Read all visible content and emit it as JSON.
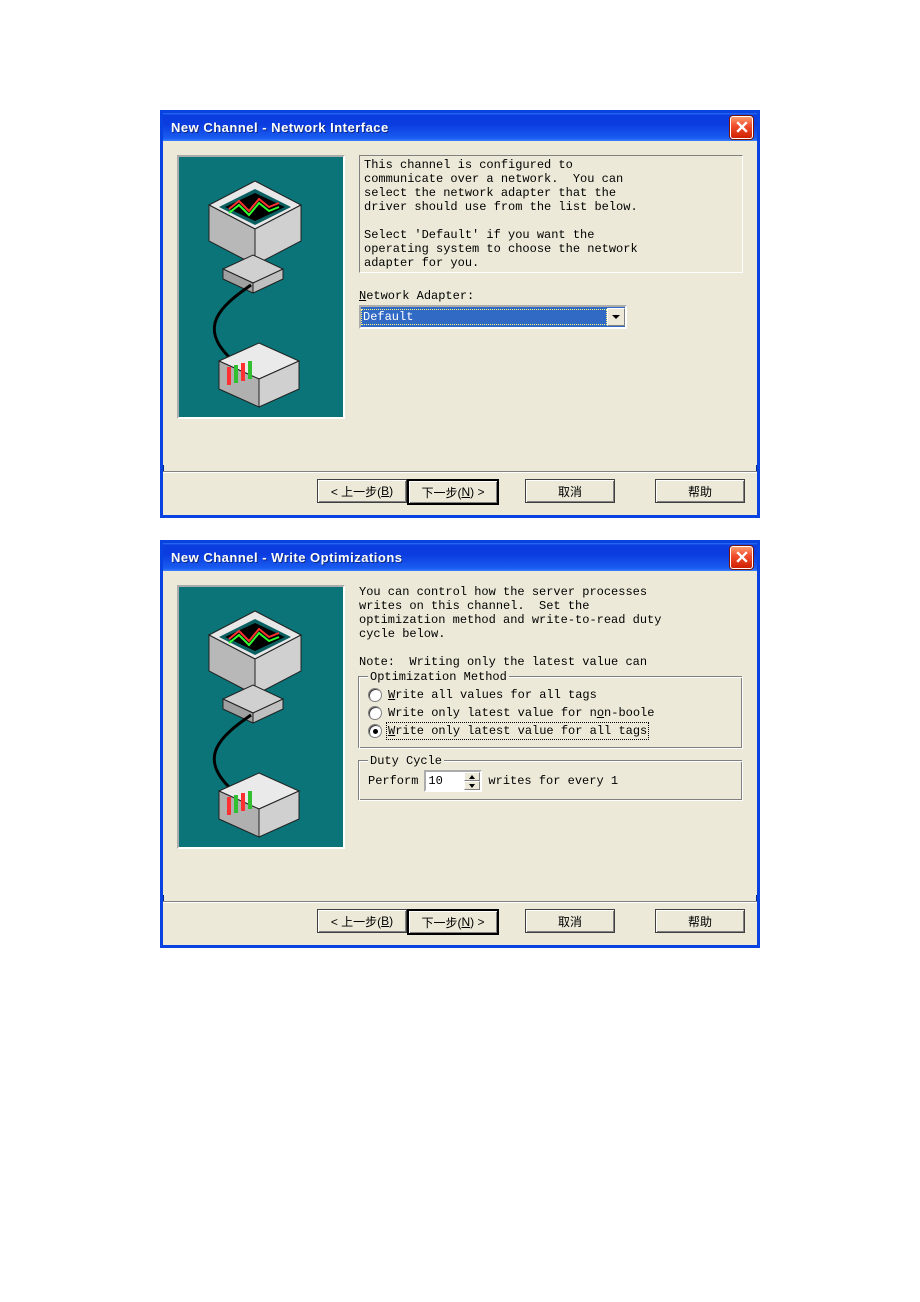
{
  "dialog1": {
    "title": "New Channel - Network Interface",
    "info_text": "This channel is configured to\ncommunicate over a network.  You can\nselect the network adapter that the\ndriver should use from the list below.\n\nSelect 'Default' if you want the\noperating system to choose the network\nadapter for you.",
    "adapter_label_pre": "N",
    "adapter_label_rest": "etwork Adapter:",
    "adapter_value": "Default",
    "buttons": {
      "back_pre": "< 上一步(",
      "back_u": "B",
      "back_post": ")",
      "next_pre": "下一步(",
      "next_u": "N",
      "next_post": ") >",
      "cancel": "取消",
      "help": "帮助"
    }
  },
  "dialog2": {
    "title": "New Channel - Write Optimizations",
    "desc_text": "You can control how the server processes\nwrites on this channel.  Set the\noptimization method and write-to-read duty\ncycle below.\n\nNote:  Writing only the latest value can",
    "opt_legend": "Optimization Method",
    "opt1_u": "W",
    "opt1_rest": "rite all values for all tags",
    "opt2_pre": "Write only latest value for n",
    "opt2_u": "o",
    "opt2_post": "n-boole",
    "opt3_u": "W",
    "opt3_rest": "rite only latest value for all tags",
    "duty_legend": "Duty Cycle",
    "perform_u": "P",
    "perform_rest": "erform",
    "duty_value": "10",
    "perform_after": "writes for every 1",
    "buttons": {
      "back_pre": "< 上一步(",
      "back_u": "B",
      "back_post": ")",
      "next_pre": "下一步(",
      "next_u": "N",
      "next_post": ") >",
      "cancel": "取消",
      "help": "帮助"
    }
  }
}
